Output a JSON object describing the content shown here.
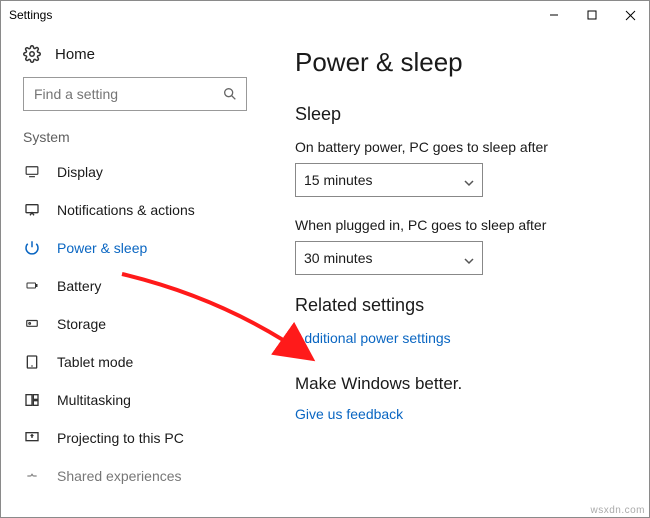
{
  "window": {
    "title": "Settings"
  },
  "home": {
    "label": "Home"
  },
  "search": {
    "placeholder": "Find a setting"
  },
  "group": {
    "label": "System"
  },
  "nav": {
    "items": [
      {
        "label": "Display"
      },
      {
        "label": "Notifications & actions"
      },
      {
        "label": "Power & sleep"
      },
      {
        "label": "Battery"
      },
      {
        "label": "Storage"
      },
      {
        "label": "Tablet mode"
      },
      {
        "label": "Multitasking"
      },
      {
        "label": "Projecting to this PC"
      },
      {
        "label": "Shared experiences"
      }
    ]
  },
  "page": {
    "title": "Power & sleep",
    "sleep": {
      "heading": "Sleep",
      "battery_label": "On battery power, PC goes to sleep after",
      "battery_value": "15 minutes",
      "plugged_label": "When plugged in, PC goes to sleep after",
      "plugged_value": "30 minutes"
    },
    "related": {
      "heading": "Related settings",
      "link": "Additional power settings"
    },
    "better": {
      "heading": "Make Windows better.",
      "link": "Give us feedback"
    }
  },
  "watermark": "wsxdn.com"
}
